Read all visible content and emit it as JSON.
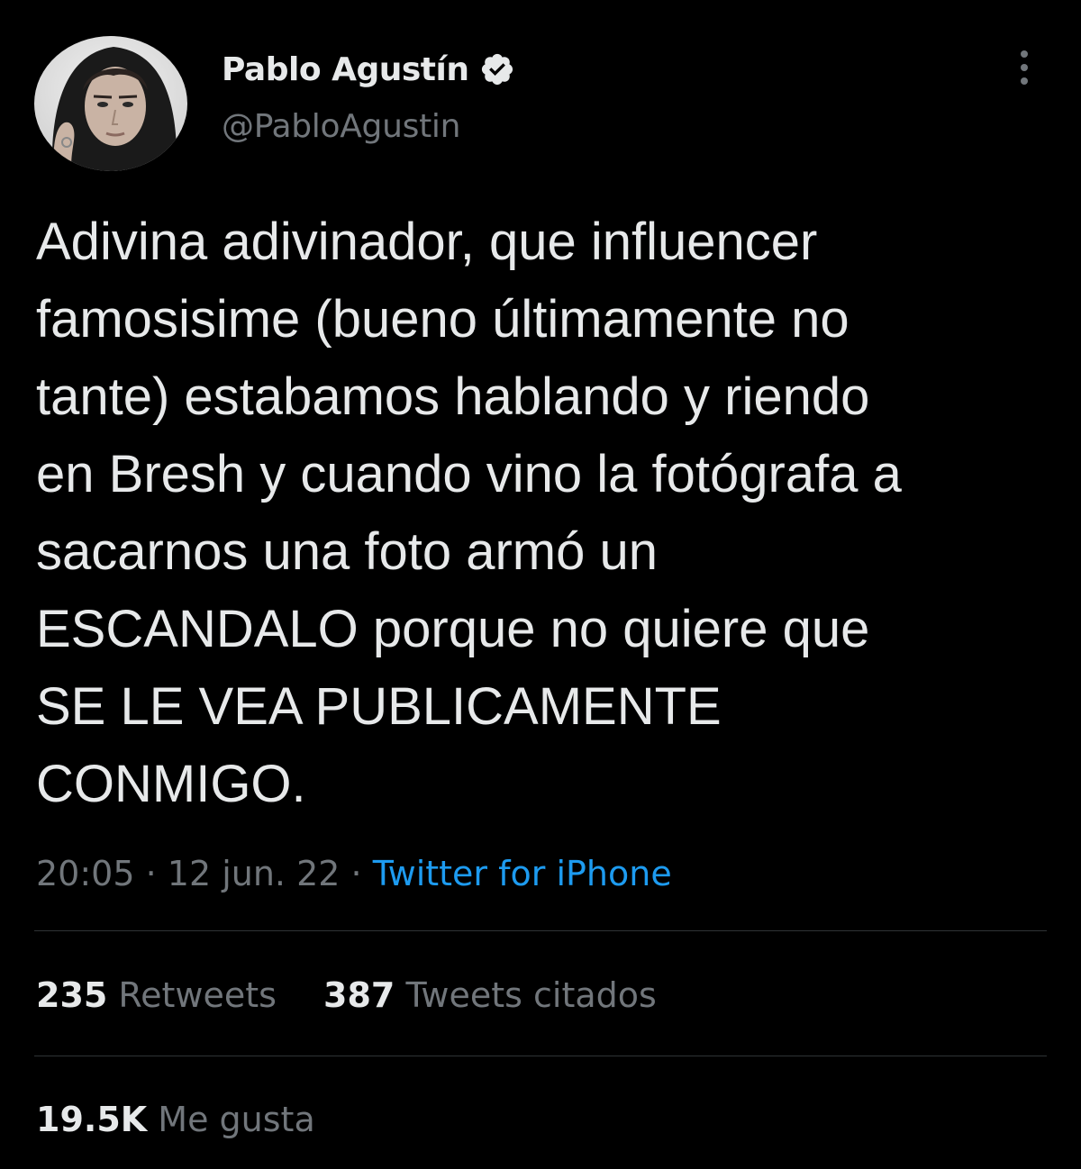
{
  "author": {
    "display_name": "Pablo Agustín",
    "handle": "@PabloAgustin",
    "verified_icon": "verified-badge-icon",
    "avatar": "profile-photo"
  },
  "menu": {
    "icon": "more-vertical-icon"
  },
  "tweet": {
    "lines": [
      "Adivina adivinador, que influencer",
      "famosisime (bueno últimamente no",
      "tante) estabamos hablando y riendo",
      "en Bresh y cuando vino la fotógrafa a",
      "sacarnos una foto armó un",
      "ESCANDALO porque no quiere que",
      "SE LE VEA PUBLICAMENTE",
      "CONMIGO."
    ]
  },
  "meta": {
    "time": "20:05",
    "separator": " · ",
    "date": "12 jun. 22",
    "source": "Twitter for iPhone"
  },
  "stats": {
    "retweets_count": "235",
    "retweets_label": "Retweets",
    "quotes_count": "387",
    "quotes_label": "Tweets citados",
    "likes_count": "19.5K",
    "likes_label": "Me gusta"
  },
  "colors": {
    "background": "#000000",
    "text": "#e7e9ea",
    "secondary_text": "#71767b",
    "link": "#1d9bf0",
    "divider": "#2f3336"
  }
}
